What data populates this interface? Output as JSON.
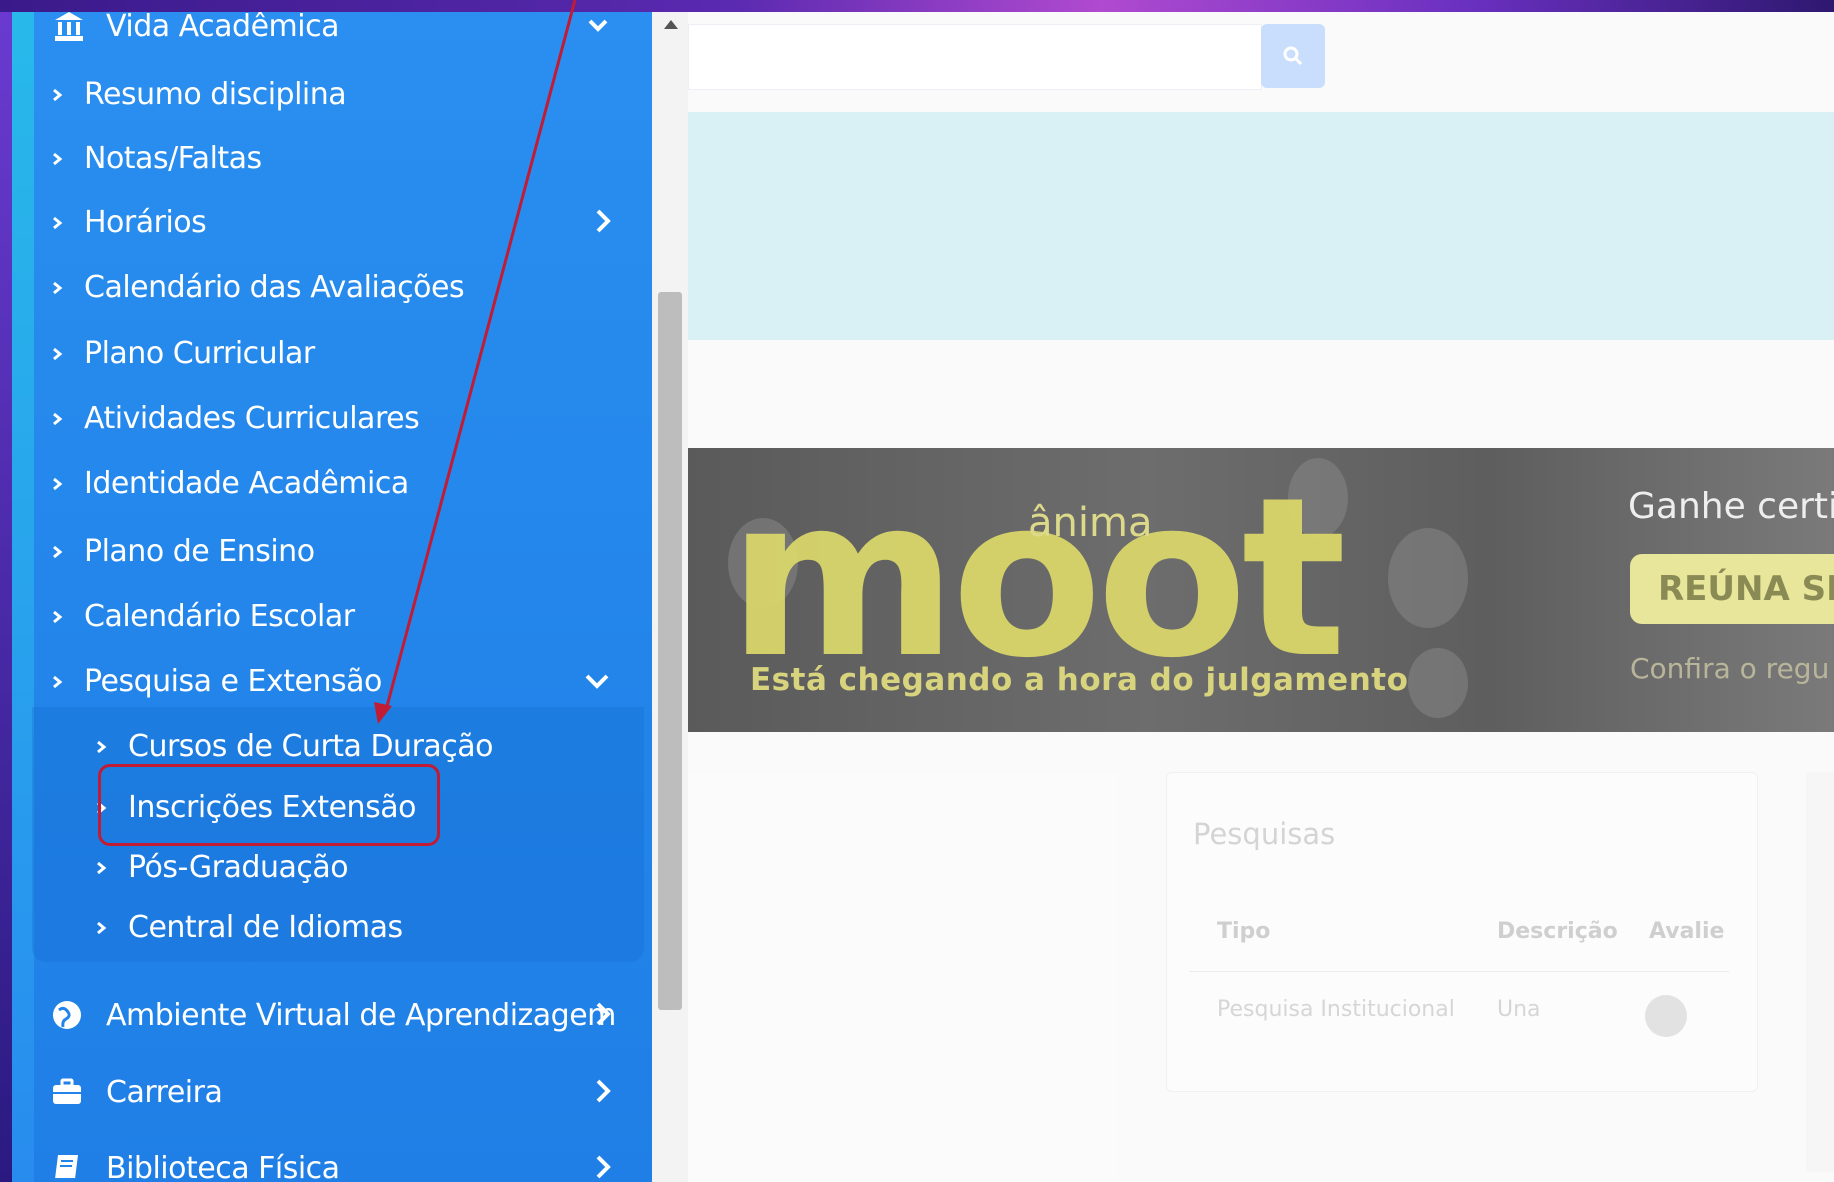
{
  "sidebar": {
    "top_partial": {
      "label": "Vida Acadêmica"
    },
    "items": [
      {
        "label": "Resumo disciplina"
      },
      {
        "label": "Notas/Faltas"
      },
      {
        "label": "Horários"
      },
      {
        "label": "Calendário das Avaliações"
      },
      {
        "label": "Plano Curricular"
      },
      {
        "label": "Atividades Curriculares"
      },
      {
        "label": "Identidade Acadêmica"
      },
      {
        "label": "Plano de Ensino"
      },
      {
        "label": "Calendário Escolar"
      },
      {
        "label": "Pesquisa e Extensão"
      }
    ],
    "subitems": [
      {
        "label": "Cursos de Curta Duração"
      },
      {
        "label": "Inscrições Extensão"
      },
      {
        "label": "Pós-Graduação"
      },
      {
        "label": "Central de Idiomas"
      }
    ],
    "sections": [
      {
        "label": "Ambiente Virtual de Aprendizagem",
        "icon": "globe-icon"
      },
      {
        "label": "Carreira",
        "icon": "briefcase-icon"
      },
      {
        "label": "Biblioteca Física",
        "icon": "book-icon"
      }
    ]
  },
  "banner": {
    "brand_small": "ânima",
    "brand_big": "moot",
    "tagline": "Está chegando a hora do julgamento",
    "headline": "Ganhe certi",
    "cta": "REÚNA SE",
    "note": "Confira o regu"
  },
  "pesquisas": {
    "title": "Pesquisas",
    "headers": [
      "Tipo",
      "Descrição",
      "Avalie"
    ],
    "row": [
      "Pesquisa Institucional",
      "Una"
    ]
  },
  "colors": {
    "sidebar": "#2385ea",
    "annotation": "#c21c34",
    "banner_text": "#d9d66b"
  }
}
